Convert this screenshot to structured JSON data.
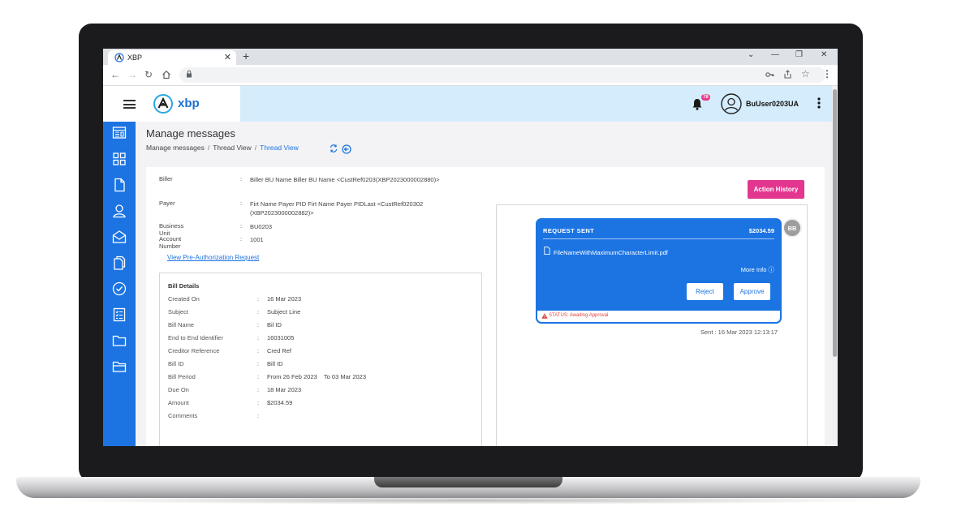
{
  "browser": {
    "tab_title": "XBP",
    "tab_close": "✕",
    "new_tab": "+",
    "window_controls": [
      "⌄",
      "—",
      "❐",
      "✕"
    ]
  },
  "header": {
    "logo_text": "xbp",
    "notification_count": "78",
    "username": "BuUser0203UA"
  },
  "page": {
    "title": "Manage messages",
    "breadcrumb": [
      "Manage messages",
      "Thread View",
      "Thread View"
    ],
    "breadcrumb_sep": "/"
  },
  "details": {
    "rows": [
      {
        "label": "Biller",
        "colon": ":",
        "value": "Biller BU Name Biller BU Name <CustRef0203(XBP2023000002880)>"
      },
      {
        "label": "Payer",
        "colon": ":",
        "value": "Firt Name Payer PID Firt Name Payer PIDLast <CustRef020302 (XBP2023000002882)>"
      },
      {
        "label": "Business Unit",
        "colon": ":",
        "value": "BU0203"
      },
      {
        "label": "Account Number",
        "colon": ":",
        "value": "1001"
      }
    ],
    "preauth_link": "View Pre-Authorization Request"
  },
  "bill_details": {
    "title": "Bill Details",
    "rows": [
      {
        "label": "Created On",
        "colon": ":",
        "value": "16 Mar 2023"
      },
      {
        "label": "Subject",
        "colon": ":",
        "value": "Subject Line"
      },
      {
        "label": "Bill Name",
        "colon": ":",
        "value": "Bil ID"
      },
      {
        "label": "End to End Identifier",
        "colon": ":",
        "value": "16031005"
      },
      {
        "label": "Creditor Reference",
        "colon": ":",
        "value": "Cred Ref"
      },
      {
        "label": "Bill ID",
        "colon": ":",
        "value": "Bill ID"
      },
      {
        "label": "Bill Period",
        "colon": ":",
        "value": "From 26 Feb 2023    To 03 Mar 2023"
      },
      {
        "label": "Due On",
        "colon": ":",
        "value": "18 Mar 2023"
      },
      {
        "label": "Amount",
        "colon": ":",
        "value": "$2034.59"
      },
      {
        "label": "Comments",
        "colon": ":",
        "value": ""
      }
    ]
  },
  "thread": {
    "action_history": "Action History",
    "message": {
      "heading": "REQUEST SENT",
      "amount": "$2034.59",
      "file_name": "FileNameWithMaximumCharacterLimit.pdf",
      "more_info": "More Info ⓘ",
      "reject": "Reject",
      "approve": "Approve",
      "status": "STATUS: Awaiting Approval"
    },
    "sender_initials": "BB",
    "sent": "Sent : 16 Mar 2023 12:13:17"
  },
  "colors": {
    "primary": "#1c74e3",
    "accent_pink": "#e3368f",
    "header_bg": "#d4ecfb",
    "status_red": "#e0443d"
  }
}
